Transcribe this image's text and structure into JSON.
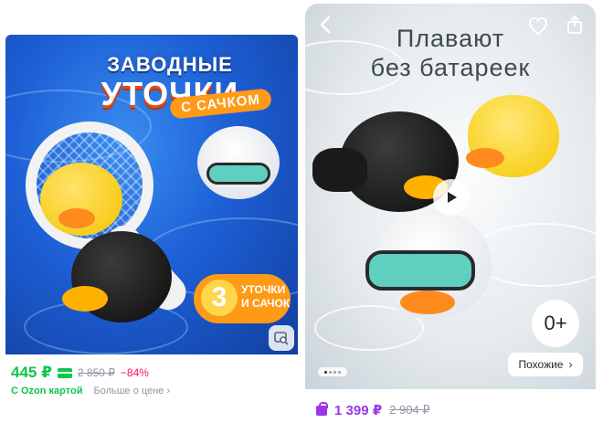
{
  "left_card": {
    "banner": {
      "line1": "ЗАВОДНЫЕ",
      "line2": "УТОЧКИ",
      "pill": "С САЧКОМ",
      "badge_number": "3",
      "badge_line1": "УТОЧКИ",
      "badge_line2": "И САЧОК"
    },
    "price": "445 ₽",
    "old_price": "2 850 ₽",
    "discount": "−84%",
    "card_label": "С Ozon картой",
    "more_price": "Больше о цене",
    "more_price_chevron": "›"
  },
  "right_card": {
    "headline_line1": "Плавают",
    "headline_line2": "без батареек",
    "age": "0+",
    "similar": "Похожие",
    "similar_chevron": "›",
    "price": "1 399 ₽",
    "old_price": "2 904 ₽"
  },
  "colors": {
    "price_green": "#10c44c",
    "discount_red": "#f91155",
    "price_purple": "#9b35e6",
    "muted": "#8f98a3"
  },
  "icons": [
    "back-icon",
    "heart-icon",
    "share-icon",
    "play-icon",
    "find-similar-icon",
    "card-icon",
    "bag-icon",
    "chevron-right-icon"
  ]
}
